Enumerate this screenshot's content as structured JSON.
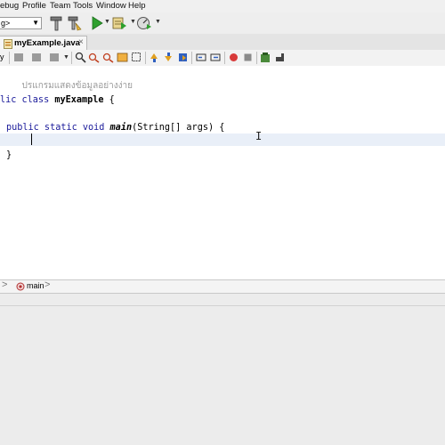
{
  "menubar": {
    "items": [
      "ebug",
      "Profile",
      "Team",
      "Tools",
      "Window",
      "Help"
    ]
  },
  "toolbar": {
    "config_value": "g>"
  },
  "tab": {
    "label": "myExample.java",
    "close_glyph": "×"
  },
  "editor": {
    "comment_line": "ปรแกรมแสดงข้อมูลอย่างง่าย",
    "class_prefix": "lic class ",
    "class_name": "myExample",
    "class_brace": " {",
    "method_prefix": "public static void ",
    "method_name": "main",
    "method_params": "(String[] args) {",
    "closing_brace": "}"
  },
  "breadcrumb": {
    "label": "main"
  },
  "colors": {
    "keyword": "#1a1a9a",
    "comment": "#9a9a9a",
    "current_line": "#e9eff8",
    "run_green": "#2ea02e",
    "record_red": "#d83a3a"
  }
}
